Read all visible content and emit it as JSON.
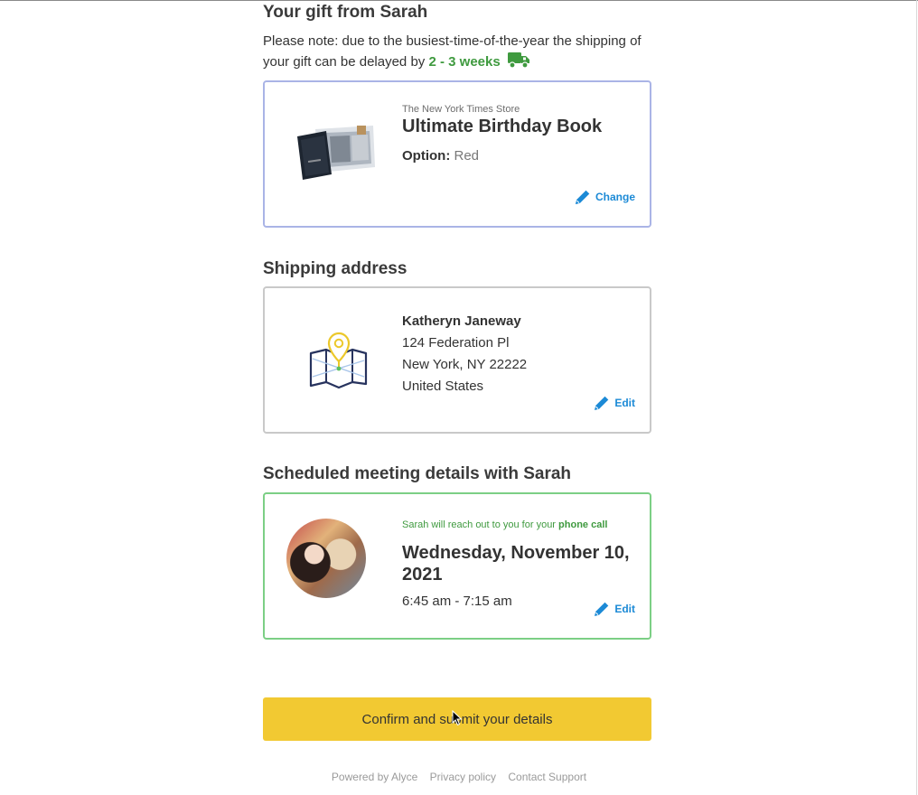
{
  "gift": {
    "heading": "Your gift from Sarah",
    "note_text": "Please note: due to the busiest-time-of-the-year the shipping of your gift can be delayed by",
    "delay": "2 - 3 weeks",
    "store": "The New York Times Store",
    "product": "Ultimate Birthday Book",
    "option_label": "Option:",
    "option_value": "Red",
    "change_label": "Change"
  },
  "shipping": {
    "heading": "Shipping address",
    "name": "Katheryn Janeway",
    "line1": "124 Federation Pl",
    "line2": "New York, NY 22222",
    "country": "United States",
    "edit_label": "Edit"
  },
  "meeting": {
    "heading": "Scheduled meeting details with Sarah",
    "note_prefix": "Sarah will reach out to you for your",
    "note_bold": "phone call",
    "date": "Wednesday, November 10, 2021",
    "time": "6:45 am - 7:15 am",
    "edit_label": "Edit"
  },
  "confirm_label": "Confirm and submit your details",
  "footer": {
    "powered": "Powered by Alyce",
    "privacy": "Privacy policy",
    "support": "Contact Support"
  },
  "colors": {
    "accent_green": "#3f9a3f",
    "link_blue": "#1c8ad6",
    "button_yellow": "#f2c932",
    "gift_border": "#aab4e6",
    "meeting_border": "#7ccf85"
  },
  "icons": {
    "truck": "truck-icon",
    "pencil": "pencil-icon",
    "map": "map-pin-icon"
  }
}
